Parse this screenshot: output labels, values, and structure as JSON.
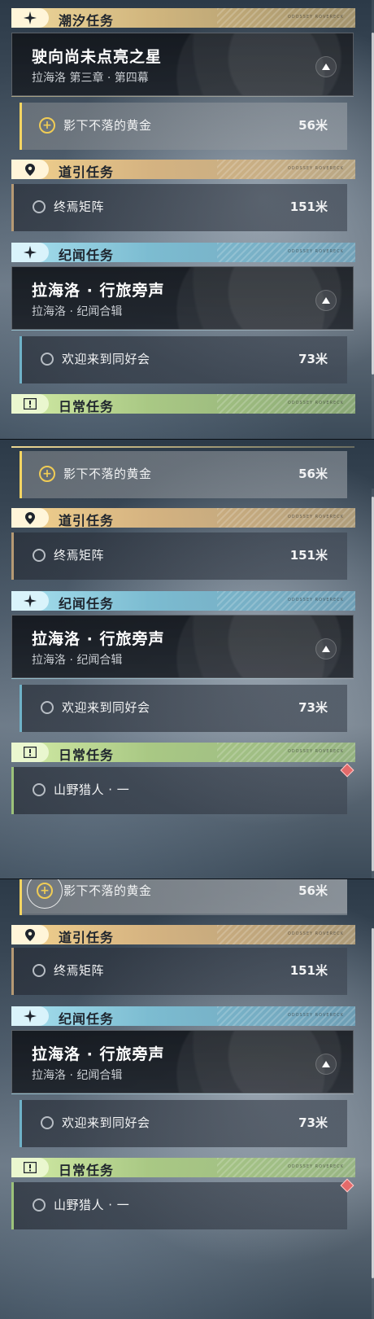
{
  "sections": {
    "tide": {
      "label": "潮汐任务"
    },
    "guide": {
      "label": "道引任务"
    },
    "lore": {
      "label": "纪闻任务"
    },
    "daily": {
      "label": "日常任务"
    }
  },
  "tag_text": "ODOSSEY ROVERECK",
  "tide_main": {
    "title": "驶向尚未点亮之星",
    "subtitle": "拉海洛 第三章 · 第四幕"
  },
  "tide_track": {
    "name": "影下不落的黄金",
    "distance": "56米"
  },
  "guide_track": {
    "name": "终焉矩阵",
    "distance": "151米"
  },
  "lore_main": {
    "title": "拉海洛 · 行旅旁声",
    "subtitle": "拉海洛 · 纪闻合辑"
  },
  "lore_track": {
    "name": "欢迎来到同好会",
    "distance": "73米"
  },
  "daily_track": {
    "name": "山野猎人 · 一"
  },
  "colors": {
    "tide": "#efd79a",
    "guide": "#f2d28e",
    "lore": "#a7e0ef",
    "daily": "#d3eca6",
    "accent": "#f0cc55",
    "alert": "#e46a6a"
  }
}
